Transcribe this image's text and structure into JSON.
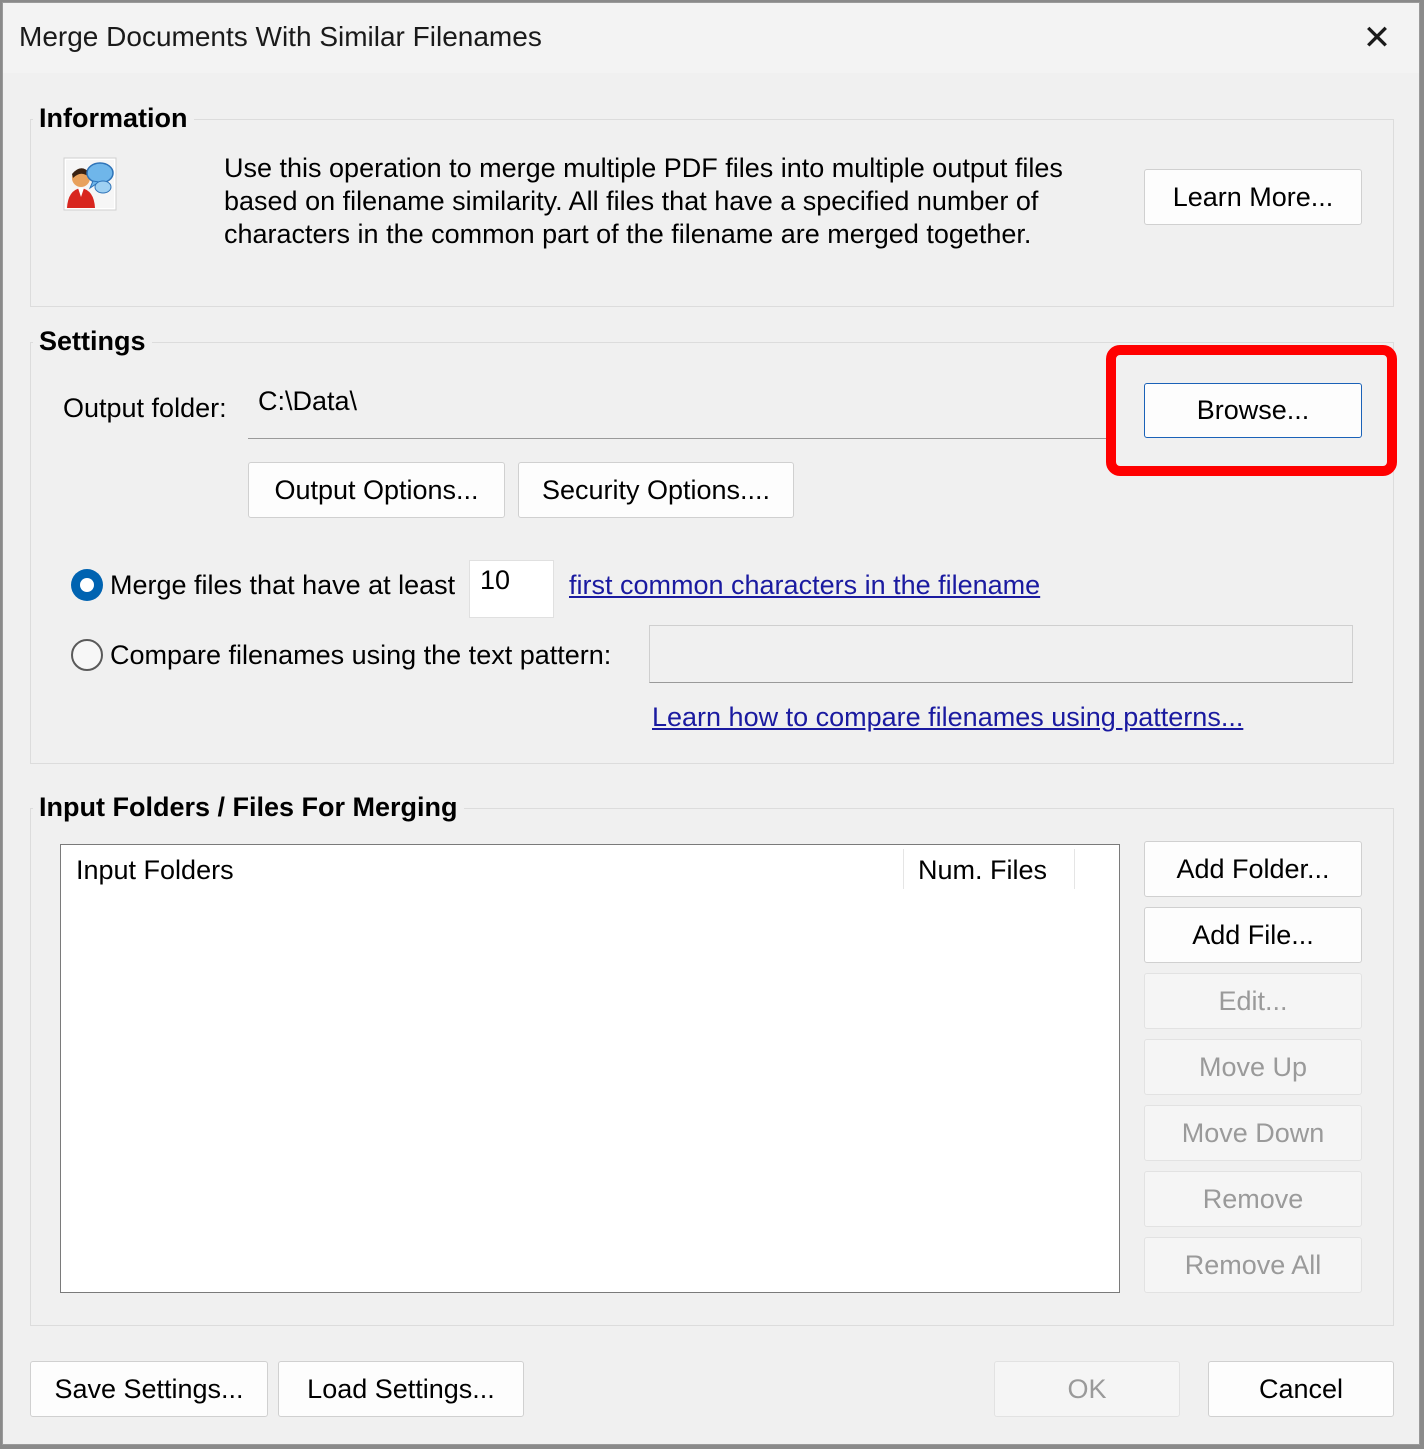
{
  "window": {
    "title": "Merge Documents With Similar Filenames"
  },
  "information": {
    "legend": "Information",
    "icon": "user-chat-icon",
    "text_line1": "Use this operation to merge multiple PDF files into multiple output files",
    "text_line2": "based on filename similarity. All files that have a specified number of",
    "text_line3": "characters in the common part of the filename are merged together.",
    "learn_more_label": "Learn More..."
  },
  "settings": {
    "legend": "Settings",
    "output_folder_label": "Output folder:",
    "output_folder_value": "C:\\Data\\",
    "browse_label": "Browse...",
    "output_options_label": "Output Options...",
    "security_options_label": "Security Options....",
    "merge_option_label": "Merge files that have at least",
    "merge_option_selected": true,
    "common_chars_value": "10",
    "common_chars_link": "first common characters in the filename",
    "pattern_option_label": "Compare filenames using the text pattern:",
    "pattern_option_selected": false,
    "pattern_value": "",
    "pattern_help_link": "Learn how to compare filenames using patterns..."
  },
  "input": {
    "legend": "Input Folders / Files For Merging",
    "columns": [
      "Input Folders",
      "Num. Files"
    ],
    "rows": [],
    "buttons": {
      "add_folder": "Add Folder...",
      "add_file": "Add File...",
      "edit": "Edit...",
      "move_up": "Move Up",
      "move_down": "Move Down",
      "remove": "Remove",
      "remove_all": "Remove All"
    }
  },
  "footer": {
    "save_settings": "Save Settings...",
    "load_settings": "Load Settings...",
    "ok": "OK",
    "cancel": "Cancel"
  },
  "colors": {
    "highlight": "#ff0000",
    "accent": "#0063b1",
    "link": "#1a1aa0"
  }
}
